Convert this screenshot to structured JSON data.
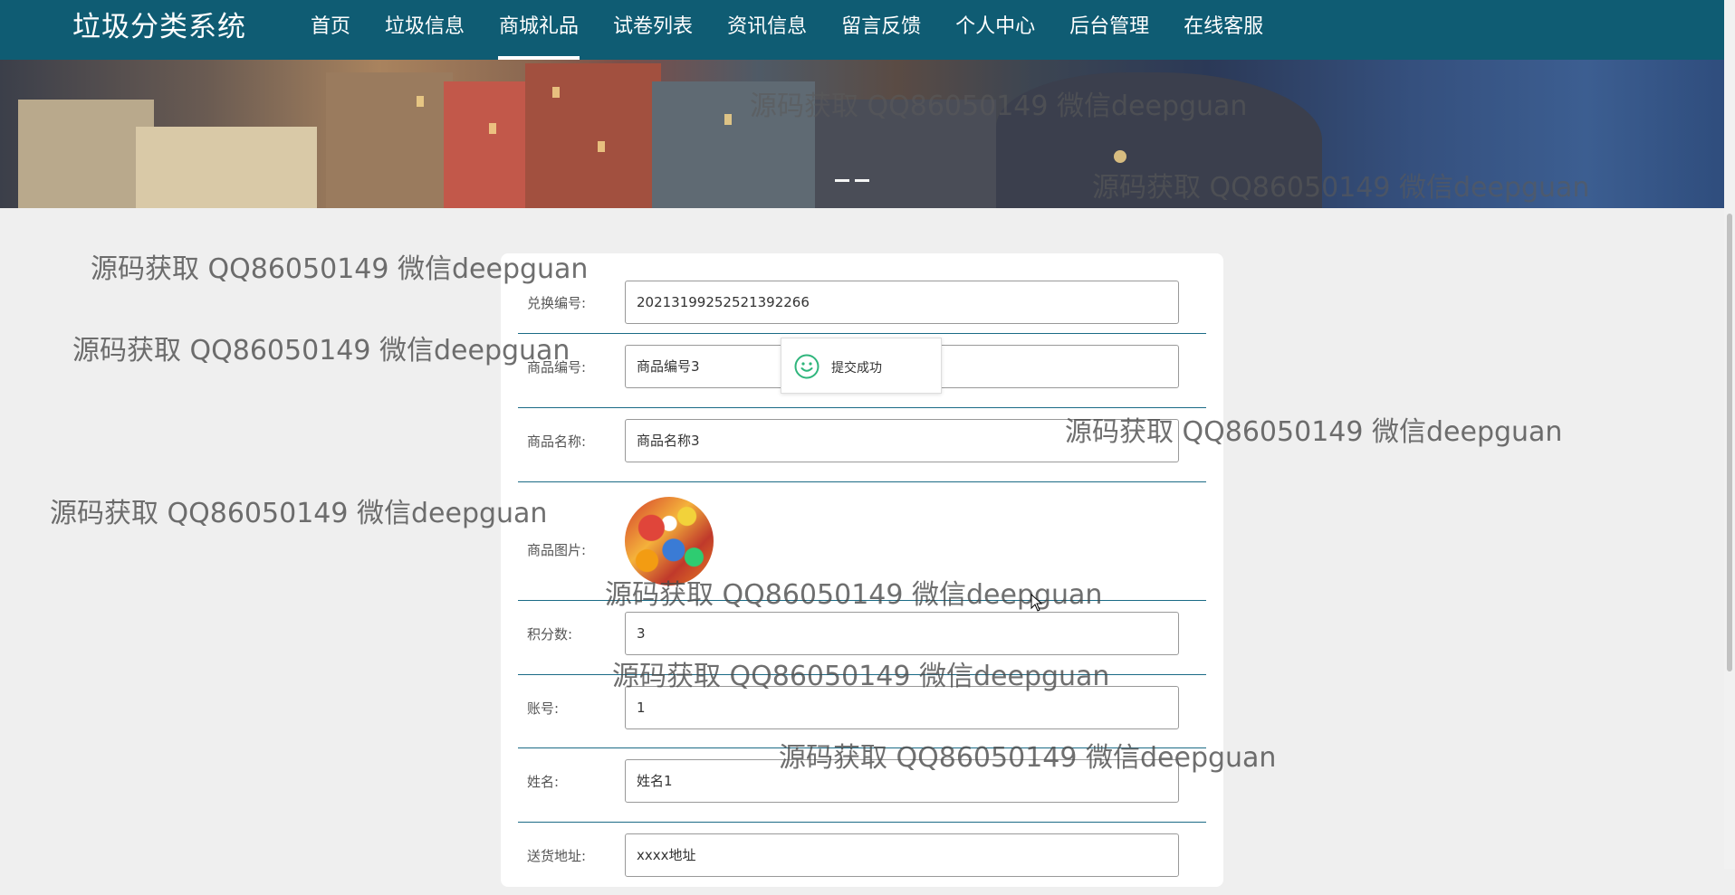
{
  "app": {
    "title": "垃圾分类系统"
  },
  "nav": {
    "items": [
      {
        "label": "首页"
      },
      {
        "label": "垃圾信息"
      },
      {
        "label": "商城礼品",
        "active": true
      },
      {
        "label": "试卷列表"
      },
      {
        "label": "资讯信息"
      },
      {
        "label": "留言反馈"
      },
      {
        "label": "个人中心"
      },
      {
        "label": "后台管理"
      },
      {
        "label": "在线客服"
      }
    ]
  },
  "form": {
    "fields": [
      {
        "label": "兑换编号:",
        "value": "20213199252521392266"
      },
      {
        "label": "商品编号:",
        "value": "商品编号3"
      },
      {
        "label": "商品名称:",
        "value": "商品名称3"
      },
      {
        "label": "商品图片:",
        "value": ""
      },
      {
        "label": "积分数:",
        "value": "3"
      },
      {
        "label": "账号:",
        "value": "1"
      },
      {
        "label": "姓名:",
        "value": "姓名1"
      },
      {
        "label": "送货地址:",
        "value": "xxxx地址"
      }
    ]
  },
  "toast": {
    "message": "提交成功",
    "icon": "smile-icon",
    "color": "#2fb57c"
  },
  "watermark": {
    "text": "源码获取 QQ86050149 微信deepguan"
  },
  "colors": {
    "nav": "#0f5c73",
    "row_border": "#1b6b86",
    "page_bg": "#efefef"
  }
}
